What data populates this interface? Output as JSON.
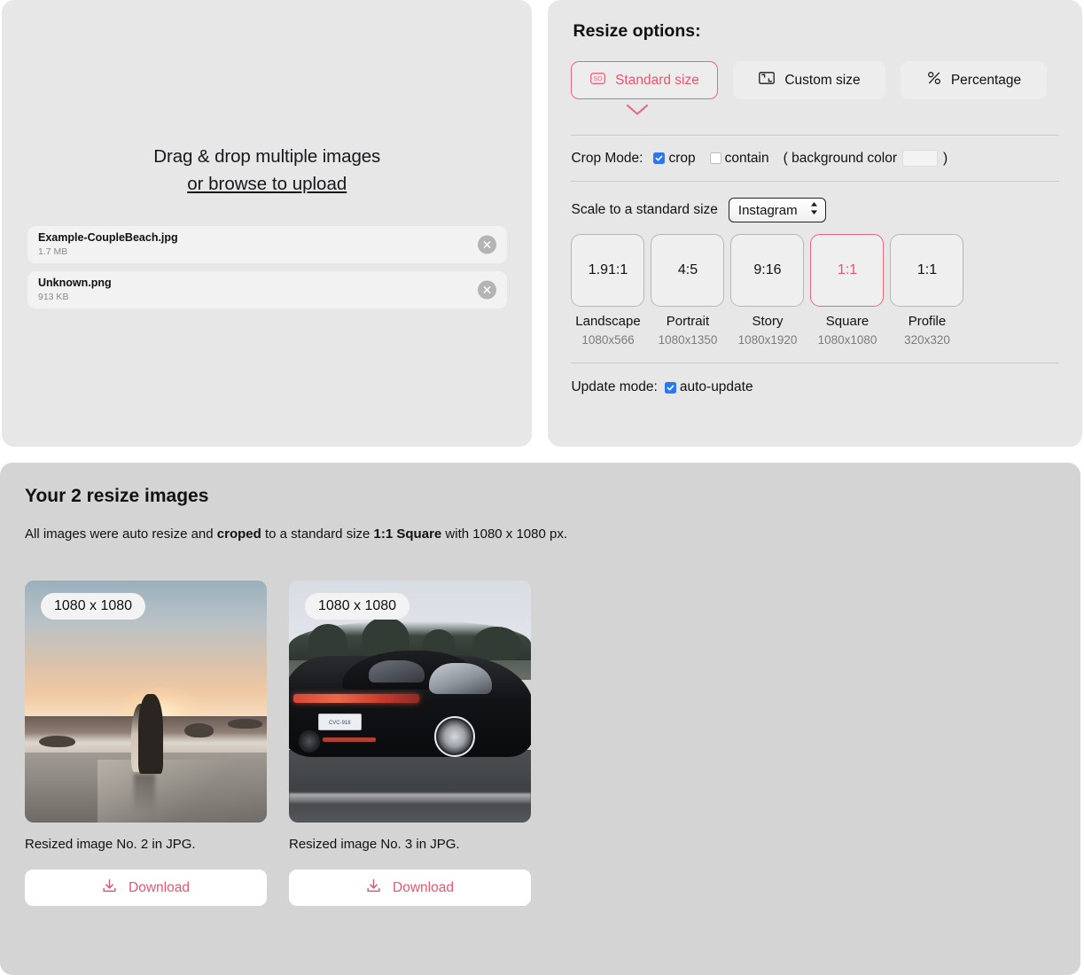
{
  "upload": {
    "drop_line1": "Drag & drop multiple images",
    "drop_line2": "or browse to upload",
    "files": [
      {
        "name": "Example-CoupleBeach.jpg",
        "size": "1.7 MB",
        "remove_icon": "close-circle-icon"
      },
      {
        "name": "Unknown.png",
        "size": "913 KB",
        "remove_icon": "close-circle-icon"
      }
    ]
  },
  "options": {
    "title": "Resize options:",
    "tabs": [
      {
        "label": "Standard size",
        "icon": "sd-badge-icon",
        "selected": true
      },
      {
        "label": "Custom size",
        "icon": "crop-frame-icon",
        "selected": false
      },
      {
        "label": "Percentage",
        "icon": "percent-icon",
        "selected": false
      }
    ],
    "expand_icon": "chevron-down-icon",
    "crop_mode": {
      "label": "Crop Mode:",
      "crop_label": "crop",
      "crop_checked": true,
      "contain_label": "contain",
      "contain_checked": false,
      "bg_prefix": "( background color",
      "bg_suffix": ")",
      "bg_color": "#f3f3f3"
    },
    "scale": {
      "label": "Scale to a standard size",
      "selected_preset": "Instagram",
      "presets": [
        "Instagram"
      ]
    },
    "ratios": [
      {
        "ratio": "1.91:1",
        "name": "Landscape",
        "dimensions": "1080x566",
        "selected": false
      },
      {
        "ratio": "4:5",
        "name": "Portrait",
        "dimensions": "1080x1350",
        "selected": false
      },
      {
        "ratio": "9:16",
        "name": "Story",
        "dimensions": "1080x1920",
        "selected": false
      },
      {
        "ratio": "1:1",
        "name": "Square",
        "dimensions": "1080x1080",
        "selected": true
      },
      {
        "ratio": "1:1",
        "name": "Profile",
        "dimensions": "320x320",
        "selected": false
      }
    ],
    "update_mode": {
      "label": "Update mode:",
      "auto_label": "auto-update",
      "auto_checked": true
    }
  },
  "results": {
    "title": "Your 2 resize images",
    "subtitle_part1": "All images were auto resize and ",
    "subtitle_bold1": "croped",
    "subtitle_part2": " to a standard size ",
    "subtitle_bold2": "1:1 Square",
    "subtitle_part3": " with 1080 x 1080 px.",
    "cards": [
      {
        "badge": "1080 x 1080",
        "caption": "Resized image No. 2 in JPG.",
        "download_label": "Download",
        "download_icon": "download-icon",
        "thumbnail": "beach-sunset-couple"
      },
      {
        "badge": "1080 x 1080",
        "caption": "Resized image No. 3 in JPG.",
        "download_label": "Download",
        "download_icon": "download-icon",
        "thumbnail": "black-porsche-on-road",
        "plate_text": "CVC-918"
      }
    ]
  },
  "colors": {
    "accent": "#e8556f",
    "accent_border": "#e8677f",
    "checkbox_blue": "#2b77ed",
    "panel_light": "#e7e7e7",
    "panel_dark": "#d4d4d4"
  }
}
